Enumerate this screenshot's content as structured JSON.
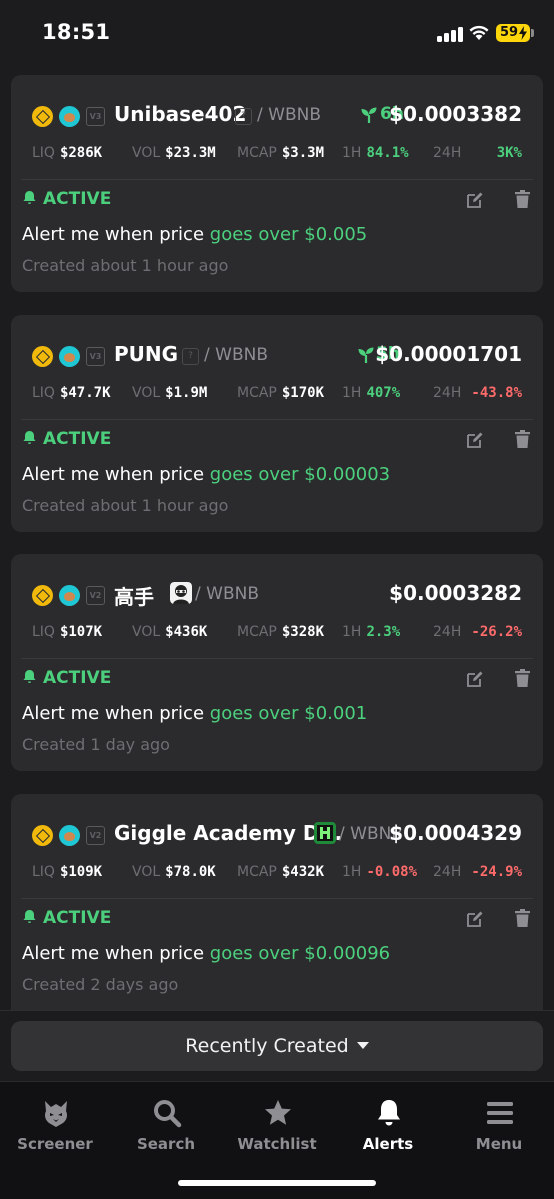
{
  "status_bar": {
    "time": "18:51",
    "battery": "59"
  },
  "alerts": [
    {
      "version": "V3",
      "name": "Unibase402",
      "quote": "/ WBNB",
      "age": "6h",
      "price": "$0.0003382",
      "stats": {
        "liq_label": "LIQ",
        "liq": "$286K",
        "vol_label": "VOL",
        "vol": "$23.3M",
        "mcap_label": "MCAP",
        "mcap": "$3.3M",
        "h1_label": "1H",
        "h1": "84.1%",
        "h24_label": "24H",
        "h24": "3K%"
      },
      "status": "ACTIVE",
      "text": "Alert me when price ",
      "condition": "goes over $0.005",
      "created": "Created about 1 hour ago"
    },
    {
      "version": "V3",
      "name": "PUNG",
      "quote": "/ WBNB",
      "age": "5h",
      "price": "$0.00001701",
      "stats": {
        "liq_label": "LIQ",
        "liq": "$47.7K",
        "vol_label": "VOL",
        "vol": "$1.9M",
        "mcap_label": "MCAP",
        "mcap": "$170K",
        "h1_label": "1H",
        "h1": "407%",
        "h24_label": "24H",
        "h24": "-43.8%"
      },
      "status": "ACTIVE",
      "text": "Alert me when price ",
      "condition": "goes over $0.00003",
      "created": "Created about 1 hour ago"
    },
    {
      "version": "V2",
      "name": "高手",
      "quote": "/ WBNB",
      "age": "",
      "price": "$0.0003282",
      "stats": {
        "liq_label": "LIQ",
        "liq": "$107K",
        "vol_label": "VOL",
        "vol": "$436K",
        "mcap_label": "MCAP",
        "mcap": "$328K",
        "h1_label": "1H",
        "h1": "2.3%",
        "h24_label": "24H",
        "h24": "-26.2%"
      },
      "status": "ACTIVE",
      "text": "Alert me when price ",
      "condition": "goes over $0.001",
      "created": "Created 1 day ago"
    },
    {
      "version": "V2",
      "name": "Giggle Academy D...",
      "quote": "/ WBNB",
      "age": "",
      "price": "$0.0004329",
      "stats": {
        "liq_label": "LIQ",
        "liq": "$109K",
        "vol_label": "VOL",
        "vol": "$78.0K",
        "mcap_label": "MCAP",
        "mcap": "$432K",
        "h1_label": "1H",
        "h1": "-0.08%",
        "h24_label": "24H",
        "h24": "-24.9%"
      },
      "status": "ACTIVE",
      "text": "Alert me when price ",
      "condition": "goes over $0.00096",
      "created": "Created 2 days ago"
    }
  ],
  "sort": {
    "label": "Recently Created"
  },
  "tabs": [
    {
      "label": "Screener",
      "icon": "screener-logo-icon"
    },
    {
      "label": "Search",
      "icon": "search-icon"
    },
    {
      "label": "Watchlist",
      "icon": "star-icon"
    },
    {
      "label": "Alerts",
      "icon": "bell-icon",
      "active": true
    },
    {
      "label": "Menu",
      "icon": "menu-icon"
    }
  ],
  "colors": {
    "background": "#1c1c1f",
    "card": "#2b2b2e",
    "green": "#4cd07d",
    "red": "#ff6b6b",
    "muted": "#6e6e73"
  }
}
